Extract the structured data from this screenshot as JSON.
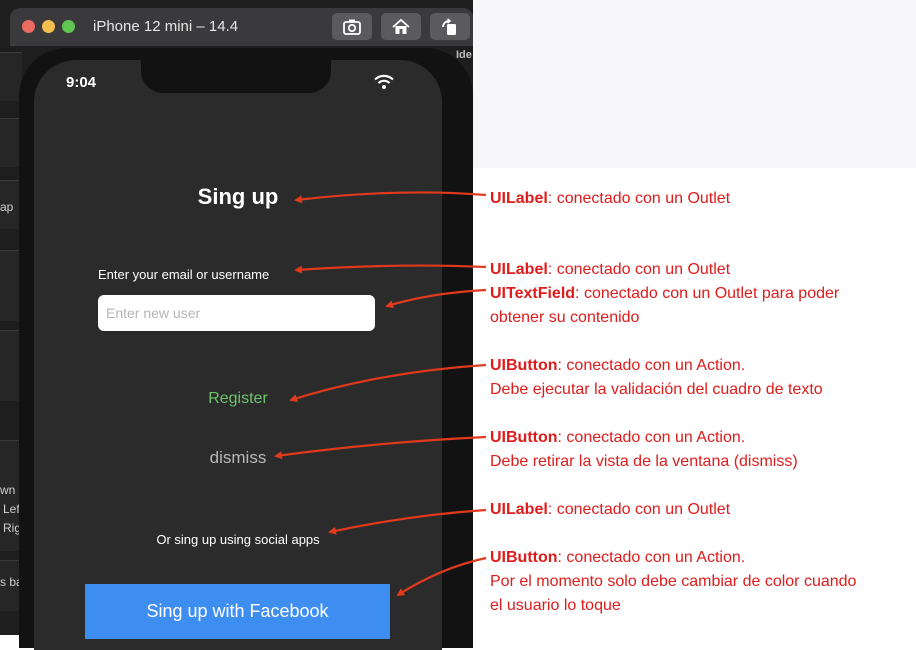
{
  "simulator": {
    "title": "iPhone 12 mini – 14.4",
    "toolbar": [
      "screenshot-icon",
      "home-icon",
      "rotate-icon"
    ]
  },
  "xcode_fragments": [
    "ap",
    "wn",
    "Lef",
    "Rig",
    "s ba",
    "Ide"
  ],
  "phone": {
    "status_time": "9:04",
    "title": "Sing up",
    "email_label": "Enter your email or username",
    "input_placeholder": "Enter new user",
    "register_label": "Register",
    "dismiss_label": "dismiss",
    "social_label": "Or sing up using social apps",
    "facebook_label": "Sing up with Facebook",
    "colors": {
      "register": "#6cc46c",
      "facebook": "#3d8ef0"
    }
  },
  "annotations": [
    {
      "type": "UILabel",
      "lines": [
        ":  conectado con un Outlet"
      ]
    },
    {
      "type": "UILabel",
      "lines": [
        ":  conectado con un Outlet"
      ]
    },
    {
      "type": "UITextField",
      "lines": [
        ": conectado con un Outlet para poder",
        "obtener su contenido"
      ]
    },
    {
      "type": "UIButton",
      "lines": [
        ": conectado con un Action.",
        "Debe ejecutar la validación del cuadro de texto"
      ]
    },
    {
      "type": "UIButton",
      "lines": [
        ": conectado con un Action.",
        "Debe retirar la vista de la ventana (dismiss)"
      ]
    },
    {
      "type": "UILabel",
      "lines": [
        ":  conectado con un Outlet"
      ]
    },
    {
      "type": "UIButton",
      "lines": [
        ": conectado con un Action.",
        "Por el momento solo debe cambiar de color cuando",
        "el usuario lo toque"
      ]
    }
  ],
  "annotation_color": "#e01b1b"
}
